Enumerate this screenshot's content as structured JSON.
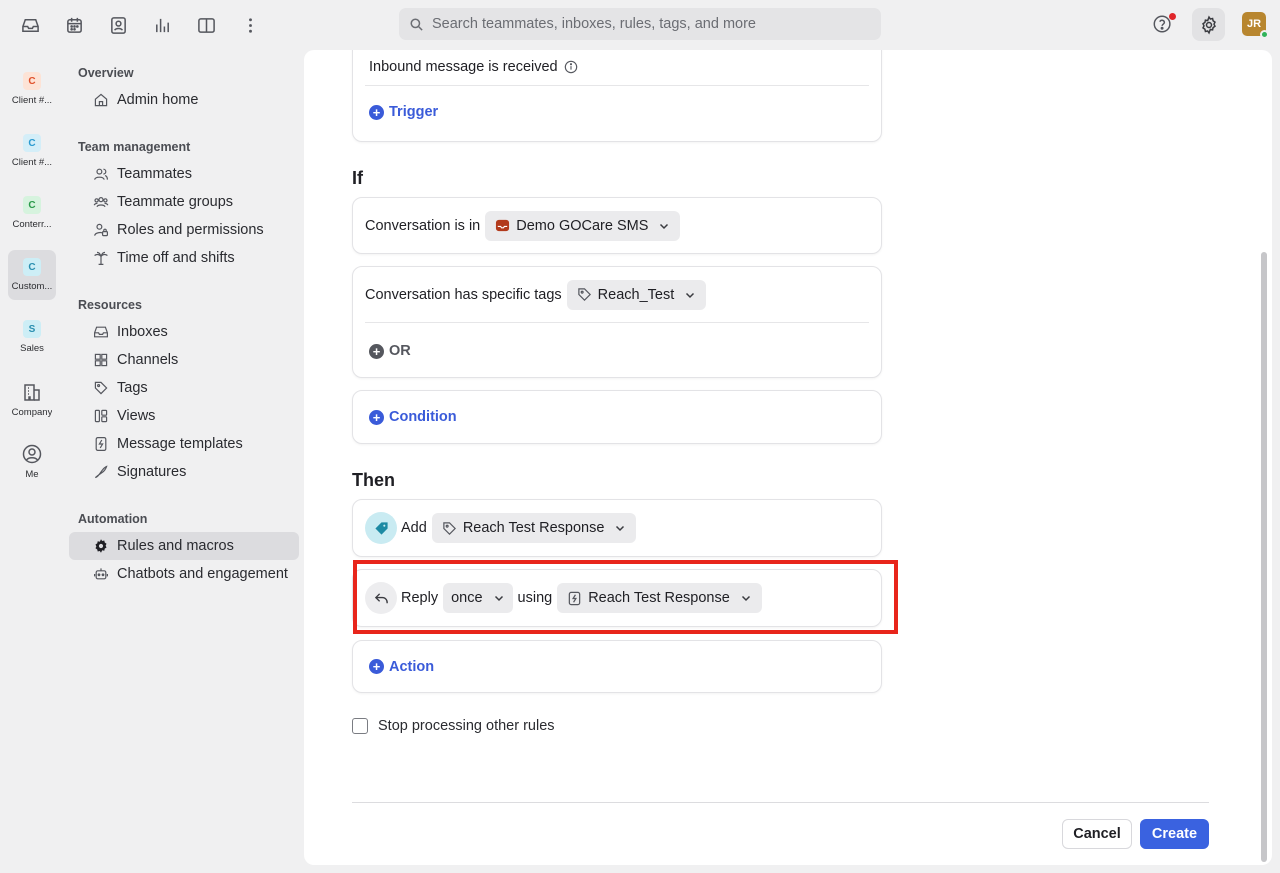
{
  "topbar": {
    "search_placeholder": "Search teammates, inboxes, rules, tags, and more",
    "avatar_initials": "JR",
    "icons": [
      "inbox-icon",
      "calendar-icon",
      "contacts-icon",
      "analytics-icon",
      "split-view-icon",
      "more-icon"
    ]
  },
  "rail": [
    {
      "badge": "C",
      "label": "Client #...",
      "badge_bg": "#fde3d6",
      "badge_color": "#e0502a"
    },
    {
      "badge": "C",
      "label": "Client #...",
      "badge_bg": "#d4eef8",
      "badge_color": "#2a9ad0"
    },
    {
      "badge": "C",
      "label": "Conterr...",
      "badge_bg": "#d6f3de",
      "badge_color": "#2a9a4a"
    },
    {
      "badge": "C",
      "label": "Custom...",
      "badge_bg": "#cdeef6",
      "badge_color": "#2a8fb0"
    },
    {
      "badge": "S",
      "label": "Sales",
      "badge_bg": "#cdeef6",
      "badge_color": "#2a8fb0"
    },
    {
      "label": "Company"
    },
    {
      "label": "Me"
    }
  ],
  "nav": {
    "overview": "Overview",
    "admin_home": "Admin home",
    "team_management": "Team management",
    "teammates": "Teammates",
    "teammate_groups": "Teammate groups",
    "roles": "Roles and permissions",
    "time_off": "Time off and shifts",
    "resources": "Resources",
    "inboxes": "Inboxes",
    "channels": "Channels",
    "tags": "Tags",
    "views": "Views",
    "templates": "Message templates",
    "signatures": "Signatures",
    "automation": "Automation",
    "rules_macros": "Rules and macros",
    "chatbots": "Chatbots and engagement"
  },
  "rule": {
    "trigger_text": "Inbound message is received",
    "add_trigger": "Trigger",
    "if_heading": "If",
    "cond1_label": "Conversation is in",
    "cond1_value": "Demo GOCare SMS",
    "cond2_label": "Conversation has specific tags",
    "cond2_value": "Reach_Test",
    "or_label": "OR",
    "add_condition": "Condition",
    "then_heading": "Then",
    "action1_label": "Add",
    "action1_value": "Reach Test Response",
    "action2_label": "Reply",
    "action2_freq": "once",
    "action2_using": "using",
    "action2_value": "Reach Test Response",
    "add_action": "Action",
    "stop_label": "Stop processing other rules",
    "stop_checked": false
  },
  "footer": {
    "cancel": "Cancel",
    "create": "Create"
  },
  "colors": {
    "accent": "#3a62e0",
    "highlight": "#e8251b"
  }
}
